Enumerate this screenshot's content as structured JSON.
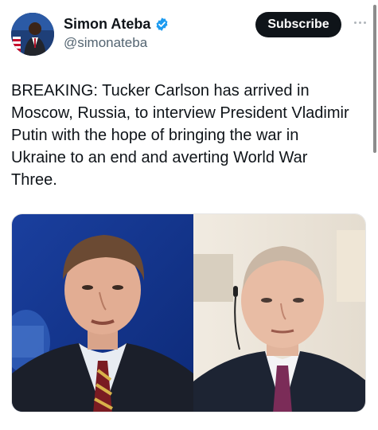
{
  "author": {
    "display_name": "Simon Ateba",
    "handle": "@simonateba",
    "verified": true,
    "verified_icon": "verified-badge-icon"
  },
  "actions": {
    "subscribe_label": "Subscribe",
    "more_icon": "more-horizontal-icon"
  },
  "tweet": {
    "text": "BREAKING: Tucker Carlson has arrived in\nMoscow, Russia, to interview President Vladimir\nPutin with the hope of bringing the war in\nUkraine to an end and averting World War\nThree."
  },
  "media": {
    "images": [
      "tucker-carlson-photo",
      "vladimir-putin-photo"
    ]
  },
  "colors": {
    "verified_blue": "#1d9bf0",
    "button_dark": "#0f1419",
    "handle_gray": "#536471"
  }
}
